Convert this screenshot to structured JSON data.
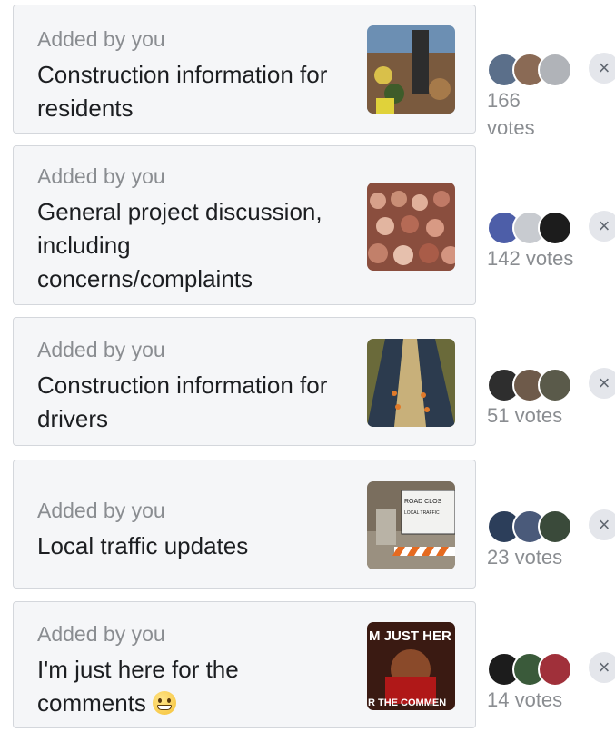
{
  "topics": [
    {
      "added_label": "Added by you",
      "title": "Construction information for residents",
      "votes": "166 votes",
      "thumbnail": "construction-crowd-photo",
      "avatar_colors": [
        "#5b6f8a",
        "#8a6a55",
        "#b0b3b8"
      ],
      "close_glyph": "×"
    },
    {
      "added_label": "Added by you",
      "title": "General project discussion, including concerns/complaints",
      "votes": "142 votes",
      "thumbnail": "crowd-photo",
      "avatar_colors": [
        "#4d5ea8",
        "#c8cbd0",
        "#1c1c1c"
      ],
      "close_glyph": "×"
    },
    {
      "added_label": "Added by you",
      "title": "Construction information for drivers",
      "votes": "51 votes",
      "thumbnail": "highway-cones-photo",
      "avatar_colors": [
        "#2e2e2e",
        "#6e5a4a",
        "#5a5a4a"
      ],
      "close_glyph": "×"
    },
    {
      "added_label": "Added by you",
      "title": "Local traffic updates",
      "votes": "23 votes",
      "thumbnail": "road-closed-sign-photo",
      "thumbnail_text": [
        "ROAD CLOS",
        "LOCAL TRAFFIC"
      ],
      "avatar_colors": [
        "#2c3e5a",
        "#4a5a7a",
        "#3a4a3a"
      ],
      "close_glyph": "×"
    },
    {
      "added_label": "Added by you",
      "title": "I'm just here for the comments",
      "title_emoji": "grinning-face-emoji",
      "votes": "14 votes",
      "thumbnail": "meme-photo",
      "thumbnail_text": [
        "M JUST HER",
        "R THE COMMEN"
      ],
      "avatar_colors": [
        "#1c1c1c",
        "#3a5a3a",
        "#a0303a"
      ],
      "close_glyph": "×"
    }
  ]
}
